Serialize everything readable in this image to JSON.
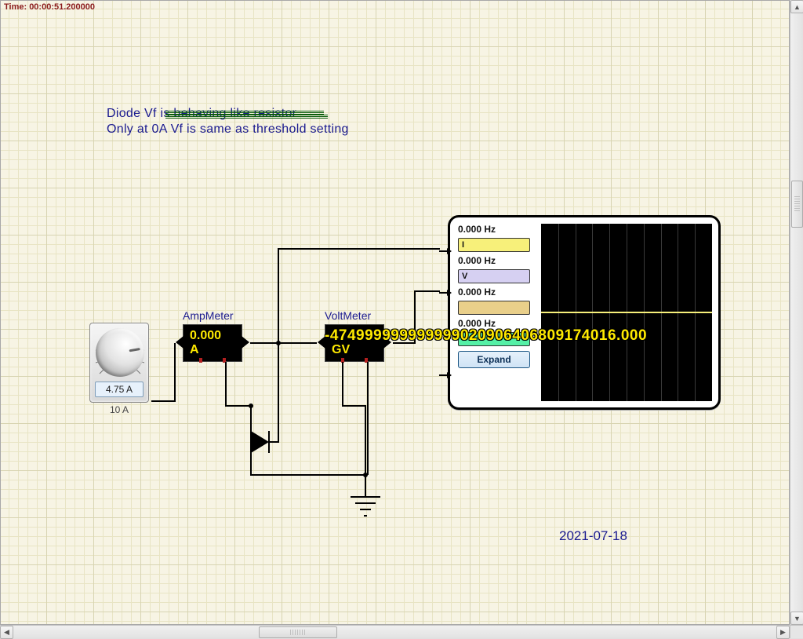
{
  "sim": {
    "time_label": "Time: 00:00:51.200000"
  },
  "annotation": {
    "line1_keep": "Diode Vf ",
    "line1_struck": "is behaving like resistor",
    "line2": "Only at 0A Vf is same as threshold setting",
    "date": "2021-07-18"
  },
  "knob": {
    "readout": "4.75 A",
    "caption": "10 A"
  },
  "ampmeter": {
    "label": "AmpMeter",
    "value_line1": "0.000",
    "value_line2": "A"
  },
  "voltmeter": {
    "label": "VoltMeter",
    "overflow_text": "-474999999999999020906406809174016.000",
    "value_line2": "GV"
  },
  "scope": {
    "ch1_hz": "0.000 Hz",
    "ch1_name": "I",
    "ch2_hz": "0.000 Hz",
    "ch2_name": "V",
    "ch3_hz": "0.000 Hz",
    "ch4_hz": "0.000 Hz",
    "expand_label": "Expand"
  }
}
